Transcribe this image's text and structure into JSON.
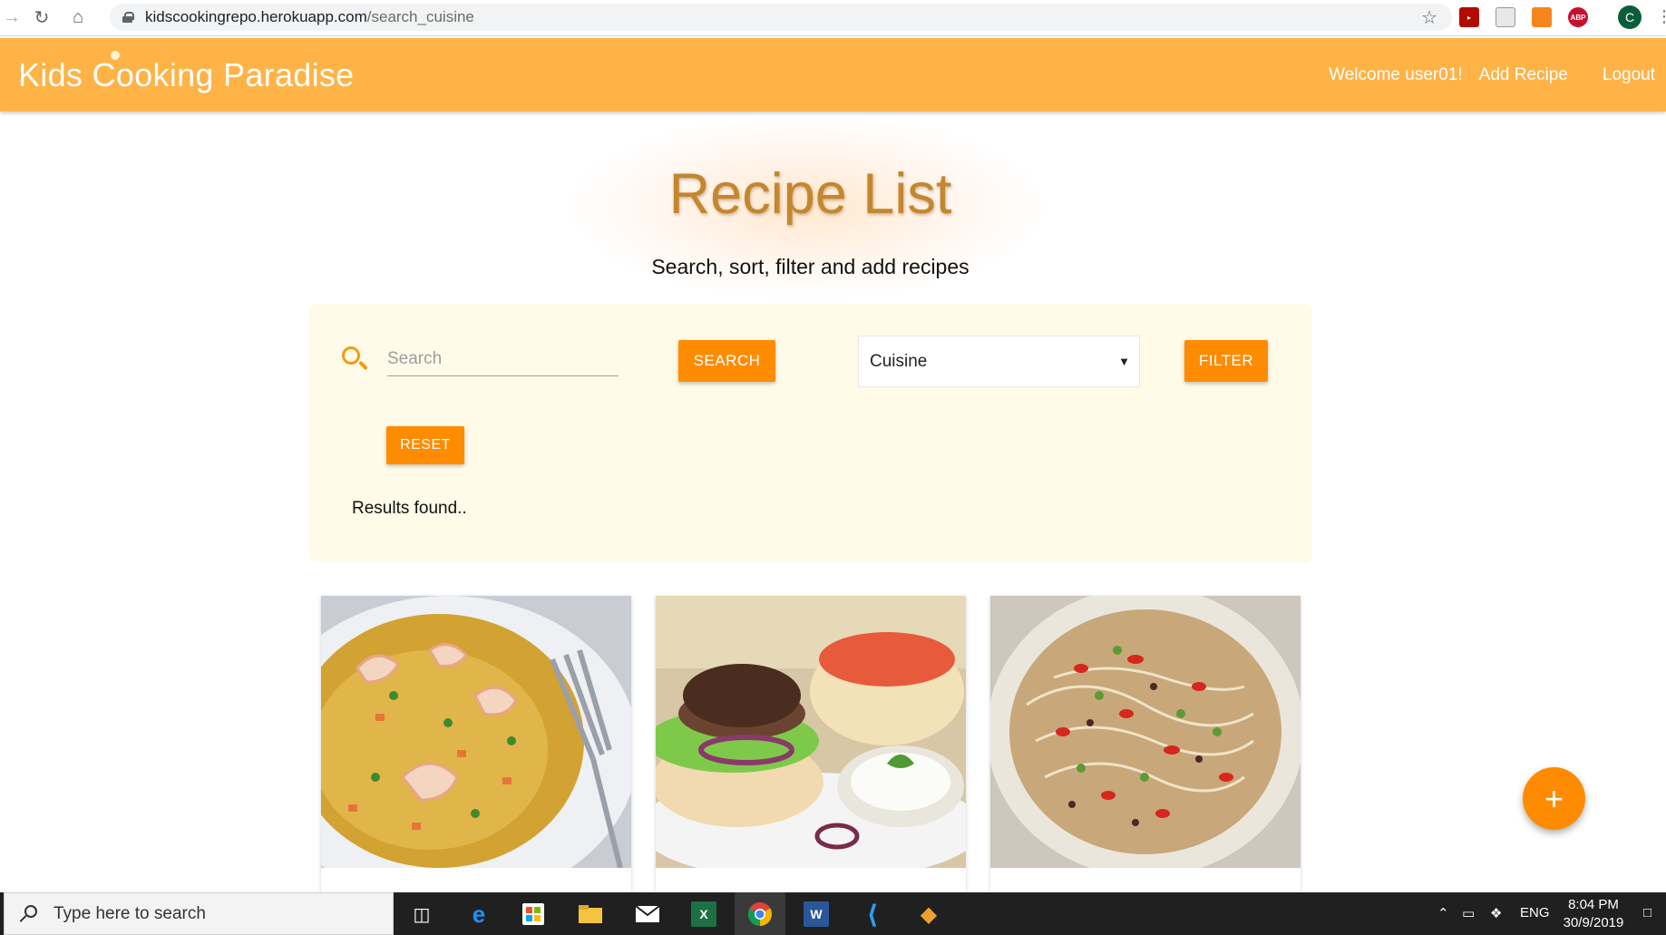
{
  "browser": {
    "url_host": "kidscookingrepo.herokuapp.com",
    "url_path": "/search_cuisine",
    "profile_initial": "C",
    "ext_abp": "ABP"
  },
  "header": {
    "brand": "Kids Cooking Paradise",
    "welcome": "Welcome user01!",
    "add_recipe": "Add Recipe",
    "logout": "Logout"
  },
  "hero": {
    "title": "Recipe List",
    "subtitle": "Search, sort, filter and add recipes"
  },
  "search_panel": {
    "search_placeholder": "Search",
    "search_value": "",
    "search_button": "SEARCH",
    "cuisine_selected": "Cuisine",
    "filter_button": "FILTER",
    "reset_button": "RESET",
    "results_text": "Results found.."
  },
  "fab": {
    "label": "+"
  },
  "taskbar": {
    "search_placeholder": "Type here to search",
    "language": "ENG",
    "time": "8:04 PM",
    "date": "30/9/2019"
  }
}
